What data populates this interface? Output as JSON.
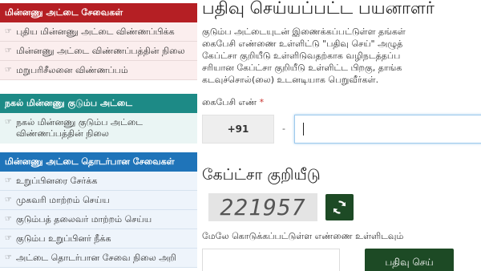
{
  "sidebar": {
    "card_services": {
      "header": "மின்னணு அட்டை சேவைகள்",
      "items": [
        {
          "label": "புதிய மின்னணு அட்டை விண்ணப்பிக்க"
        },
        {
          "label": "மின்னணு அட்டை விண்ணப்பத்தின் நிலை"
        },
        {
          "label": "மறுபரிசீலனை விண்ணப்பம்"
        }
      ]
    },
    "duplicate_card": {
      "header": "நகல் மின்னணு குடும்ப அட்டை",
      "items": [
        {
          "label": "நகல் மின்னணு குடும்ப அட்டை விண்ணப்பத்தின் நிலை"
        }
      ]
    },
    "card_related": {
      "header": "மின்னணு அட்டை தொடர்பான சேவைகள்",
      "items": [
        {
          "label": "உறுப்பினரை சேர்க்க"
        },
        {
          "label": "முகவரி மாற்றம் செய்ய"
        },
        {
          "label": "குடும்பத் தலைவர் மாற்றம் செய்ய"
        },
        {
          "label": "குடும்ப உறுப்பினர் நீக்க"
        },
        {
          "label": "அட்டை தொடர்பான சேவை நிலை அறி"
        }
      ]
    }
  },
  "main": {
    "title": "பதிவு செய்யப்பட்ட பயனாளர்",
    "instructions": [
      "குடும்ப அட்டையுடன் இணைக்கப்பட்டுள்ள தங்கள்",
      "கைபேசி எண்ணை உள்ளிட்டு \"பதிவு செய்\" அழுத்",
      "கேப்ட்சா குறியீடு உள்ளிடுவதற்காக வழிநடத்தப்ப",
      "சரியான கேப்ட்சா குறியீடு உள்ளிட்ட பிறகு, தாங்க",
      "கடவுச்சொல்(லை) உடனடியாக பெறுவீர்கள்."
    ],
    "mobile_label": "கைபேசி எண்",
    "required_mark": "*",
    "country_code": "+91",
    "dash": "-",
    "mobile_value": "",
    "captcha_title": "கேப்ட்சா குறியீடு",
    "captcha_code": "221957",
    "captcha_instruction": "மேலே கொடுக்கப்பட்டுள்ள எண்ணை உள்ளிடவும்",
    "captcha_value": "",
    "submit_label": "பதிவு செய்"
  },
  "colors": {
    "red_header": "#b51f24",
    "teal_header": "#1d8a86",
    "blue_header": "#1f74b9",
    "button_green": "#1d4a25"
  },
  "icons": {
    "list_item_icon": "hand-pointer-icon",
    "refresh_icon": "refresh-icon"
  }
}
